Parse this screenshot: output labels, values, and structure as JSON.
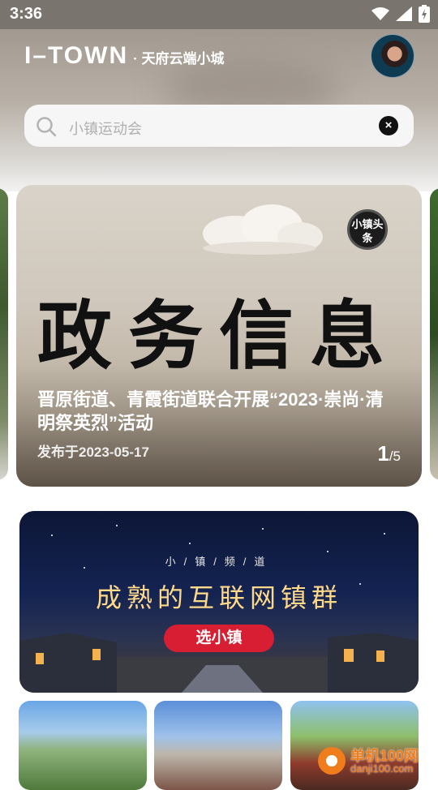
{
  "status_bar": {
    "time": "3:36",
    "icons": [
      "wifi-icon",
      "signal-icon",
      "battery-charging-icon"
    ]
  },
  "header": {
    "logo_main": "I–TOWN",
    "logo_sub": "· 天府云端小城"
  },
  "search": {
    "placeholder": "小镇运动会"
  },
  "carousel": {
    "badge": "小镇头条",
    "calligraphy": "政务信息",
    "headline": "晋原街道、青霞街道联合开展“2023·崇尚·清明祭英烈”活动",
    "date": "发布于2023-05-17",
    "current": "1",
    "total": "/5"
  },
  "channel": {
    "subtitle": "小/镇/频/道",
    "title": "成熟的互联网镇群",
    "button": "选小镇"
  },
  "watermark": {
    "line1": "单机100网",
    "line2": "danji100.com"
  },
  "colors": {
    "accent_red": "#d81e32",
    "title_gold": "#ffd98a",
    "watermark_orange": "#f07d1c"
  }
}
